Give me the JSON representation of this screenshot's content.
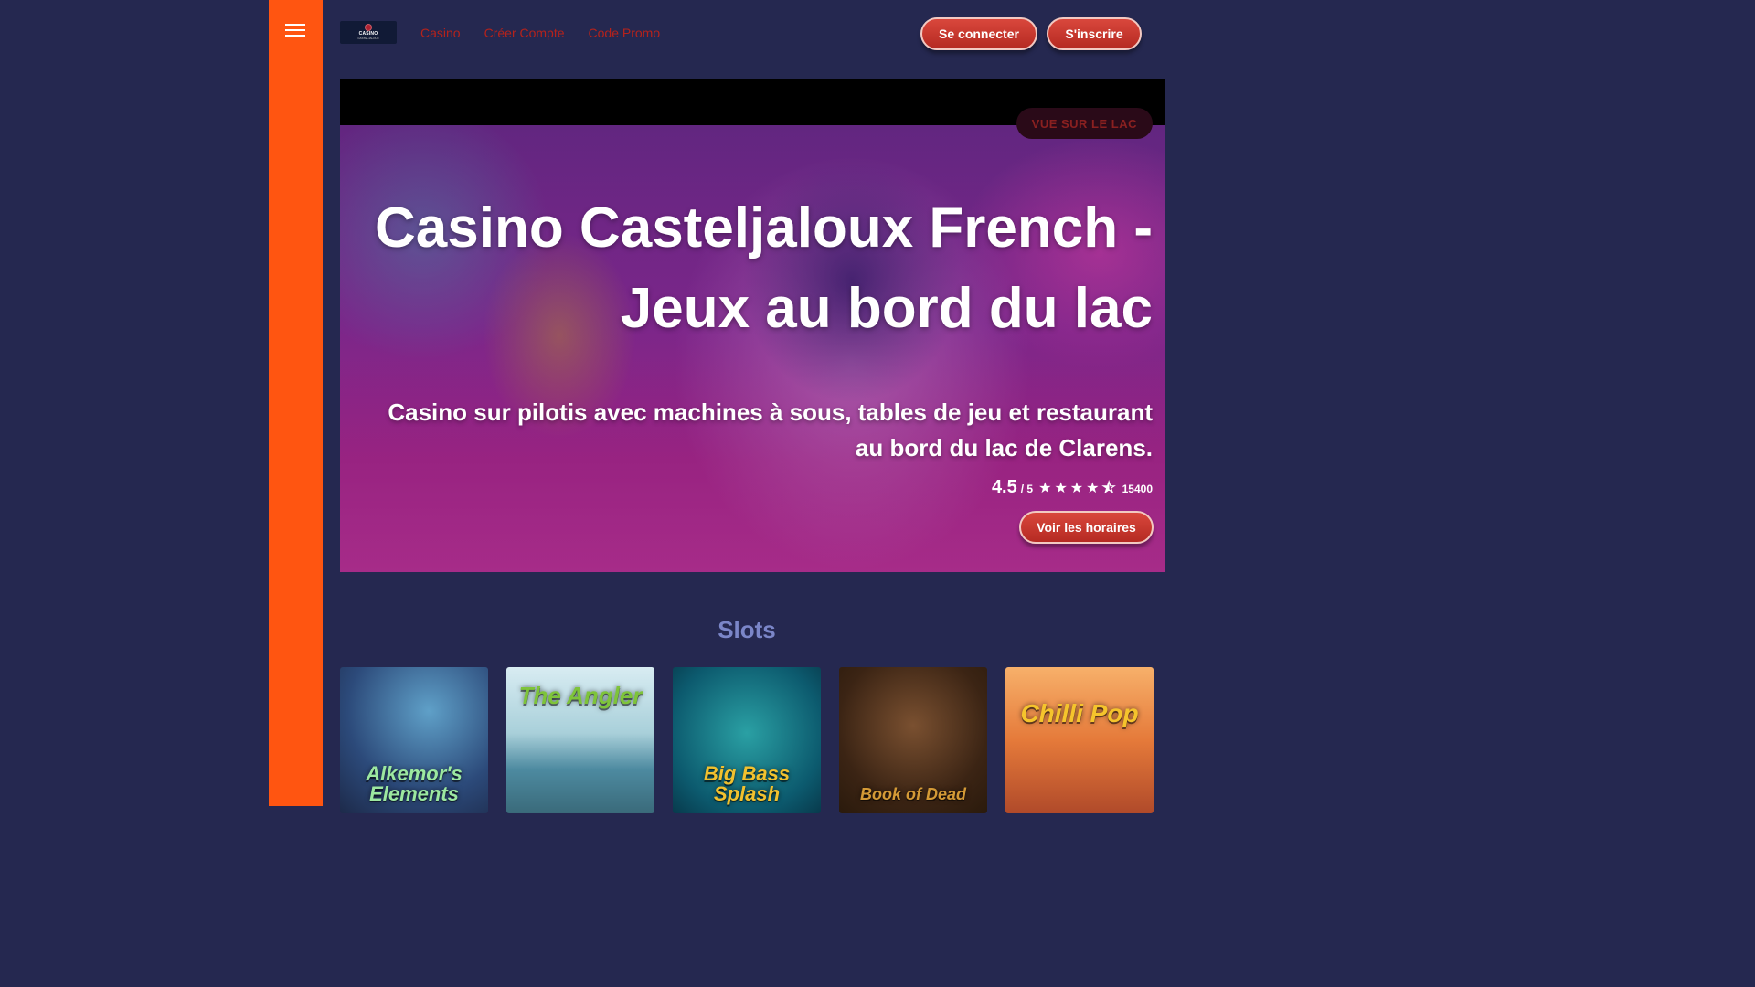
{
  "header": {
    "logo_text": "CASINO",
    "logo_sub": "CASTELJALOUX",
    "nav": [
      "Casino",
      "Créer Compte",
      "Code Promo"
    ],
    "login_label": "Se connecter",
    "signup_label": "S'inscrire"
  },
  "hero": {
    "tag": "VUE SUR LE LAC",
    "title": "Casino Casteljaloux French - Jeux au bord du lac",
    "description": "Casino sur pilotis avec machines à sous, tables de jeu et restaurant au bord du lac de Clarens.",
    "rating": {
      "score": "4.5",
      "out_of": "/ 5",
      "stars": "★★★★⯪",
      "star_value": 4.5,
      "count": "15400"
    },
    "hours_button": "Voir les horaires"
  },
  "slots": {
    "title": "Slots",
    "games": [
      {
        "name": "Alkemor's Elements"
      },
      {
        "name": "The Angler"
      },
      {
        "name": "Big Bass Splash"
      },
      {
        "name": "Book of Dead"
      },
      {
        "name": "Chilli Pop"
      }
    ]
  },
  "colors": {
    "background": "#252850",
    "sidebar": "#ff5511",
    "accent": "#c0352c",
    "nav_link": "#b5221b",
    "section_title": "#7b86c8"
  }
}
